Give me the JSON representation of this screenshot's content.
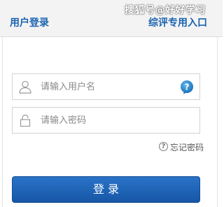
{
  "header": {
    "title": "用户登录",
    "entry_link": "综评专用入口",
    "watermark": "搜狐号@好好学习"
  },
  "form": {
    "username": {
      "placeholder": "请输入用户名",
      "icon": "user-icon",
      "help_icon": "help-icon"
    },
    "password": {
      "placeholder": "请输入密码",
      "icon": "lock-icon"
    },
    "forgot": {
      "icon": "question-circle-icon",
      "label": "忘记密码"
    },
    "login_button": "登 录"
  },
  "colors": {
    "accent": "#1a63b0",
    "button": "#1a5fb4",
    "help_icon": "#1e7fc7"
  }
}
